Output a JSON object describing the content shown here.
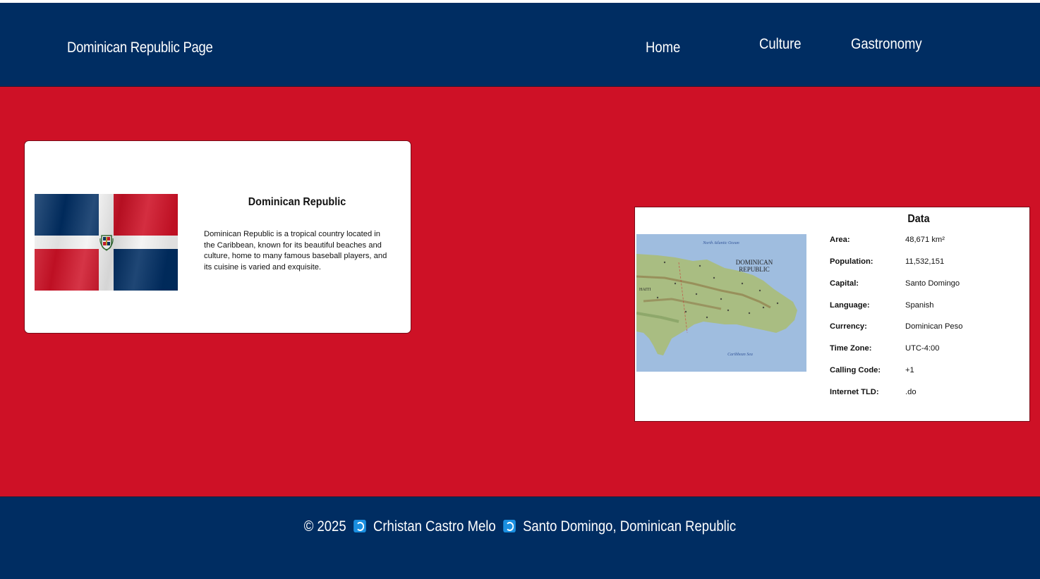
{
  "header": {
    "brand": "Dominican Republic Page",
    "nav": [
      {
        "label": "Home"
      },
      {
        "label": "Culture"
      },
      {
        "label": "Gastronomy"
      }
    ]
  },
  "country_card": {
    "title": "Dominican Republic",
    "description": "Dominican Republic is a tropical country located in the Caribbean, known for its beautiful beaches and culture, home to many famous baseball players, and its cuisine is varied and exquisite.",
    "flag_colors": {
      "blue": "#002d62",
      "red": "#ce1126",
      "white": "#f2f2f2"
    }
  },
  "data_card": {
    "title": "Data",
    "map": {
      "ocean_top": "North Atlantic Ocean",
      "country_label_1": "DOMINICAN",
      "country_label_2": "REPUBLIC",
      "neighbor": "HAITI",
      "ocean_bottom": "Caribbean Sea"
    },
    "rows": [
      {
        "key": "Area:",
        "value": "48,671 km²"
      },
      {
        "key": "Population:",
        "value": "11,532,151"
      },
      {
        "key": "Capital:",
        "value": "Santo Domingo"
      },
      {
        "key": "Language:",
        "value": "Spanish"
      },
      {
        "key": "Currency:",
        "value": "Dominican Peso"
      },
      {
        "key": "Time Zone:",
        "value": "UTC-4:00"
      },
      {
        "key": "Calling Code:",
        "value": "+1"
      },
      {
        "key": "Internet TLD:",
        "value": ".do"
      }
    ]
  },
  "footer": {
    "copyright": "© 2025",
    "author": "Crhistan Castro Melo",
    "location": "Santo Domingo, Dominican Republic",
    "icon": "wave-icon"
  },
  "colors": {
    "navy": "#002d62",
    "red": "#ce1126",
    "white": "#ffffff"
  }
}
